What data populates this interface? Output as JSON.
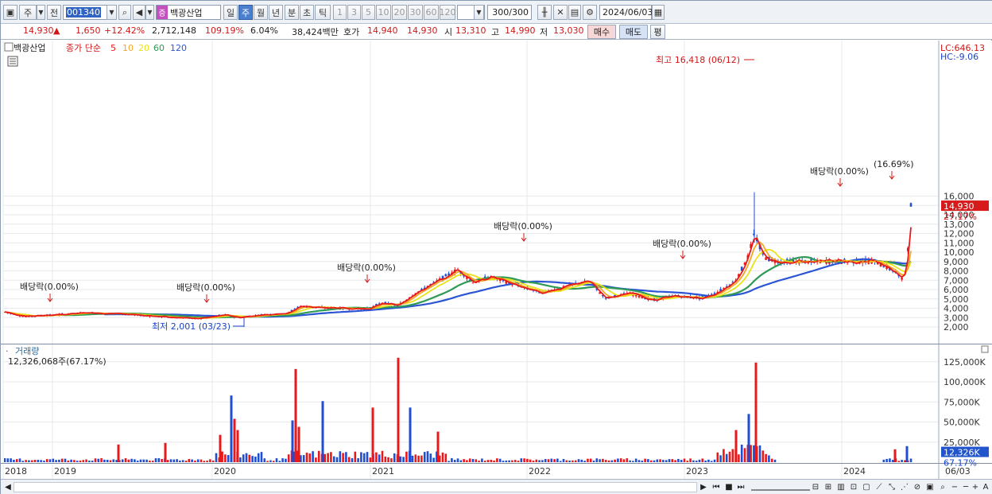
{
  "toolbar": {
    "period": "주",
    "period2": "전",
    "code": "001340",
    "company": "백광산업",
    "tabs": [
      "일",
      "주",
      "월",
      "년",
      "분",
      "초",
      "틱"
    ],
    "minute_options": [
      "1",
      "3",
      "5",
      "10",
      "20",
      "30",
      "60",
      "120"
    ],
    "count": "300",
    "count_total": "/300",
    "date": "2024/06/03"
  },
  "quote": {
    "price": "14,930",
    "arrow": "▲",
    "change": "1,650",
    "change_pct": "+12.42%",
    "volume": "2,712,148",
    "vol_ratio": "109.19%",
    "turnover": "6.04%",
    "amount": "38,424백만",
    "bid_label": "호가",
    "ask": "14,940",
    "bid": "14,930",
    "open_label": "시",
    "open": "13,310",
    "high_label": "고",
    "high": "14,990",
    "low_label": "저",
    "low": "13,030",
    "buy_label": "매수",
    "sell_label": "매도",
    "avg_label": "평"
  },
  "legend": {
    "name": "백광산업",
    "indicator": "종가 단순",
    "ma": [
      "5",
      "10",
      "20",
      "60",
      "120"
    ],
    "ma_colors": [
      "#e8191b",
      "#f5a623",
      "#e8e41a",
      "#2e9a55",
      "#2b55d4"
    ]
  },
  "price_axis": {
    "ticks": [
      "16,000",
      "15,000",
      "14,000",
      "13,000",
      "12,000",
      "11,000",
      "10,000",
      "9,000",
      "8,000",
      "7,000",
      "6,000",
      "5,000",
      "4,000",
      "3,000",
      "2,000"
    ],
    "lc": "LC:646.13",
    "hc": "HC:-9.06",
    "current": "14,930",
    "current_pct": "27.17%"
  },
  "volume_axis": {
    "ticks": [
      "125,000K",
      "100,000K",
      "75,000K",
      "50,000K",
      "25,000K"
    ],
    "current": "12,326K",
    "current_pct": "67.17%"
  },
  "volume_label": {
    "title": "거래량",
    "value": "12,326,068주(67.17%)"
  },
  "x_axis": {
    "labels": [
      "2018",
      "2019",
      "2020",
      "2021",
      "2022",
      "2023",
      "2024",
      "06/03"
    ]
  },
  "annotations": {
    "high": "최고 16,418 (06/12)",
    "low": "최저 2,001 (03/23)",
    "dividends": [
      "배당락(0.00%)",
      "배당락(0.00%)",
      "배당락(0.00%)",
      "배당락(0.00%)",
      "배당락(0.00%)",
      "배당락(0.00%)",
      "(16.69%)"
    ]
  },
  "chart_data": {
    "type": "line",
    "x": [
      "2018",
      "2019",
      "2020",
      "2021",
      "2022",
      "2023",
      "2024"
    ],
    "series": [
      {
        "values": [
          3500,
          3000,
          3200,
          4800,
          6200,
          5200,
          14930
        ]
      }
    ],
    "ylim": [
      1500,
      16500
    ]
  },
  "colors": {
    "up": "#e8191b",
    "down": "#1f4fd0",
    "ma5": "#e8191b",
    "ma10": "#f5a623",
    "ma20": "#e8e41a",
    "ma60": "#2e9a55",
    "ma120": "#2b55d4",
    "accent": "#2f64c5"
  }
}
